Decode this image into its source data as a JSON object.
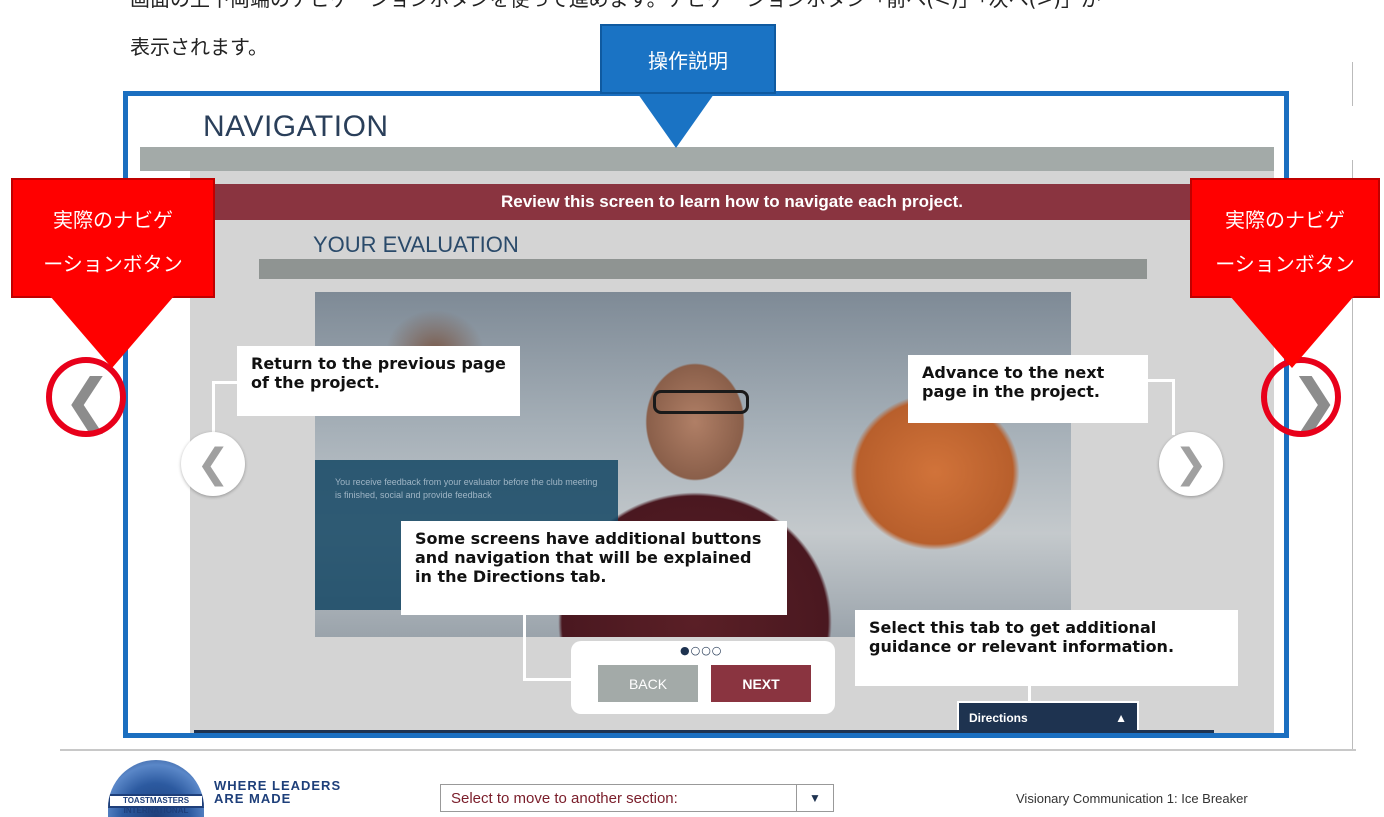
{
  "document": {
    "intro_line_1": "画面の上下両端のナビゲーションボタンを使って進めます。ナビゲーションボタン「前へ(<)」「次へ(>)」が",
    "intro_line_2": "表示されます。"
  },
  "annotations": {
    "top_label": "操作説明",
    "left_label_line1": "実際のナビゲ",
    "left_label_line2": "ーションボタン",
    "right_label_line1": "実際のナビゲ",
    "right_label_line2": "ーションボタン",
    "colors": {
      "blue": "#1a73c4",
      "red": "#ff0000"
    }
  },
  "screen": {
    "title": "NAVIGATION",
    "banner": "Review this screen to learn how to navigate each project.",
    "section_title": "YOUR EVALUATION",
    "photo_caption": "You receive feedback from your evaluator before the club meeting is finished, social and provide feedback",
    "callouts": {
      "previous": "Return to the previous page of the project.",
      "next": "Advance to the next page in the project.",
      "additional": "Some screens have additional buttons and navigation that will be explained in the Directions tab.",
      "tab": "Select this tab to get additional guidance or relevant information."
    },
    "pager": {
      "dots": "●○○○",
      "back_label": "BACK",
      "next_label": "NEXT"
    },
    "directions_tab": {
      "label": "Directions",
      "icon": "triangle-up-icon",
      "arrow": "▲"
    },
    "inner_prev_icon": "chevron-left-icon",
    "inner_next_icon": "chevron-right-icon",
    "inner_prev_glyph": "❮",
    "inner_next_glyph": "❯",
    "colors": {
      "maroon": "#8a3440",
      "navy": "#1e3350",
      "gray_bar": "#a3aaa8"
    }
  },
  "outer_nav": {
    "prev_glyph": "❮",
    "next_glyph": "❯"
  },
  "footer": {
    "logo_band": "TOASTMASTERS INTERNATIONAL",
    "logo_text_line1": "WHERE LEADERS",
    "logo_text_line2": "ARE MADE",
    "section_select": "Select to move to another section:",
    "select_arrow": "▼",
    "project_title": "Visionary Communication 1: Ice Breaker"
  }
}
